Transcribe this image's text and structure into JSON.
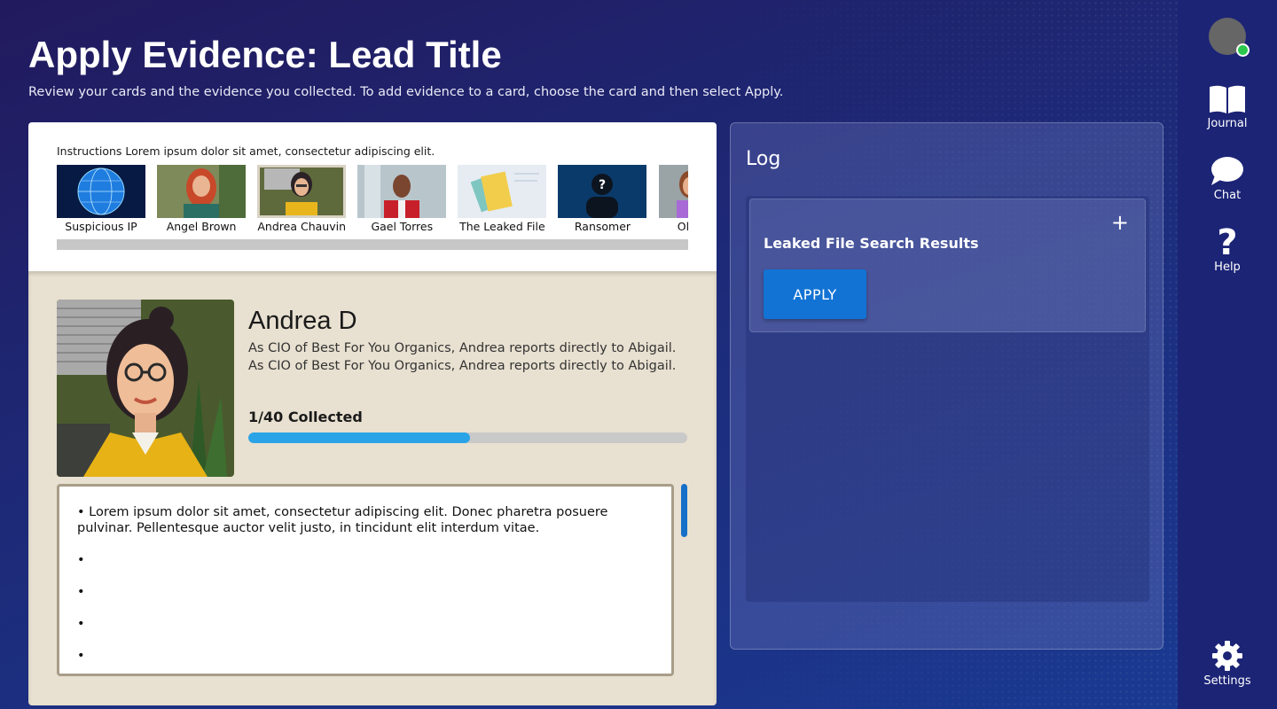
{
  "header": {
    "title": "Apply Evidence: Lead Title",
    "subtitle": "Review your cards and the evidence you collected. To add evidence to a card, choose the card and then select Apply."
  },
  "cards": {
    "instructions": "Instructions Lorem ipsum dolor sit amet, consectetur adipiscing elit.",
    "items": [
      {
        "label": "Suspicious IP"
      },
      {
        "label": "Angel Brown"
      },
      {
        "label": "Andrea Chauvin"
      },
      {
        "label": "Gael Torres"
      },
      {
        "label": "The Leaked File"
      },
      {
        "label": "Ransomer"
      },
      {
        "label": "Olivia Jac"
      }
    ],
    "selected_index": 2
  },
  "detail": {
    "name": "Andrea D",
    "description": "As CIO of Best For You Organics, Andrea reports directly to Abigail. As CIO of Best For You Organics, Andrea reports directly to Abigail.",
    "collected_label": "1/40 Collected",
    "progress_fraction": 0.505,
    "notes": [
      "• Lorem ipsum dolor sit amet, consectetur adipiscing elit. Donec pharetra posuere pulvinar. Pellentesque auctor velit justo, in tincidunt elit interdum vitae.",
      "•",
      "•",
      "•",
      "•"
    ]
  },
  "log": {
    "title": "Log",
    "entries": [
      {
        "title": "Leaked File Search Results",
        "expand_symbol": "+",
        "apply_label": "APPLY"
      }
    ]
  },
  "sidebar": {
    "items": [
      {
        "label": "Journal",
        "icon": "book-icon"
      },
      {
        "label": "Chat",
        "icon": "chat-bubble-icon"
      },
      {
        "label": "Help",
        "icon": "question-mark-icon"
      },
      {
        "label": "Settings",
        "icon": "gear-icon"
      }
    ],
    "status_color": "#2cc84d"
  },
  "colors": {
    "accent": "#1273d4",
    "progress": "#2aa4e6",
    "detail_background": "#e8e0d0"
  }
}
